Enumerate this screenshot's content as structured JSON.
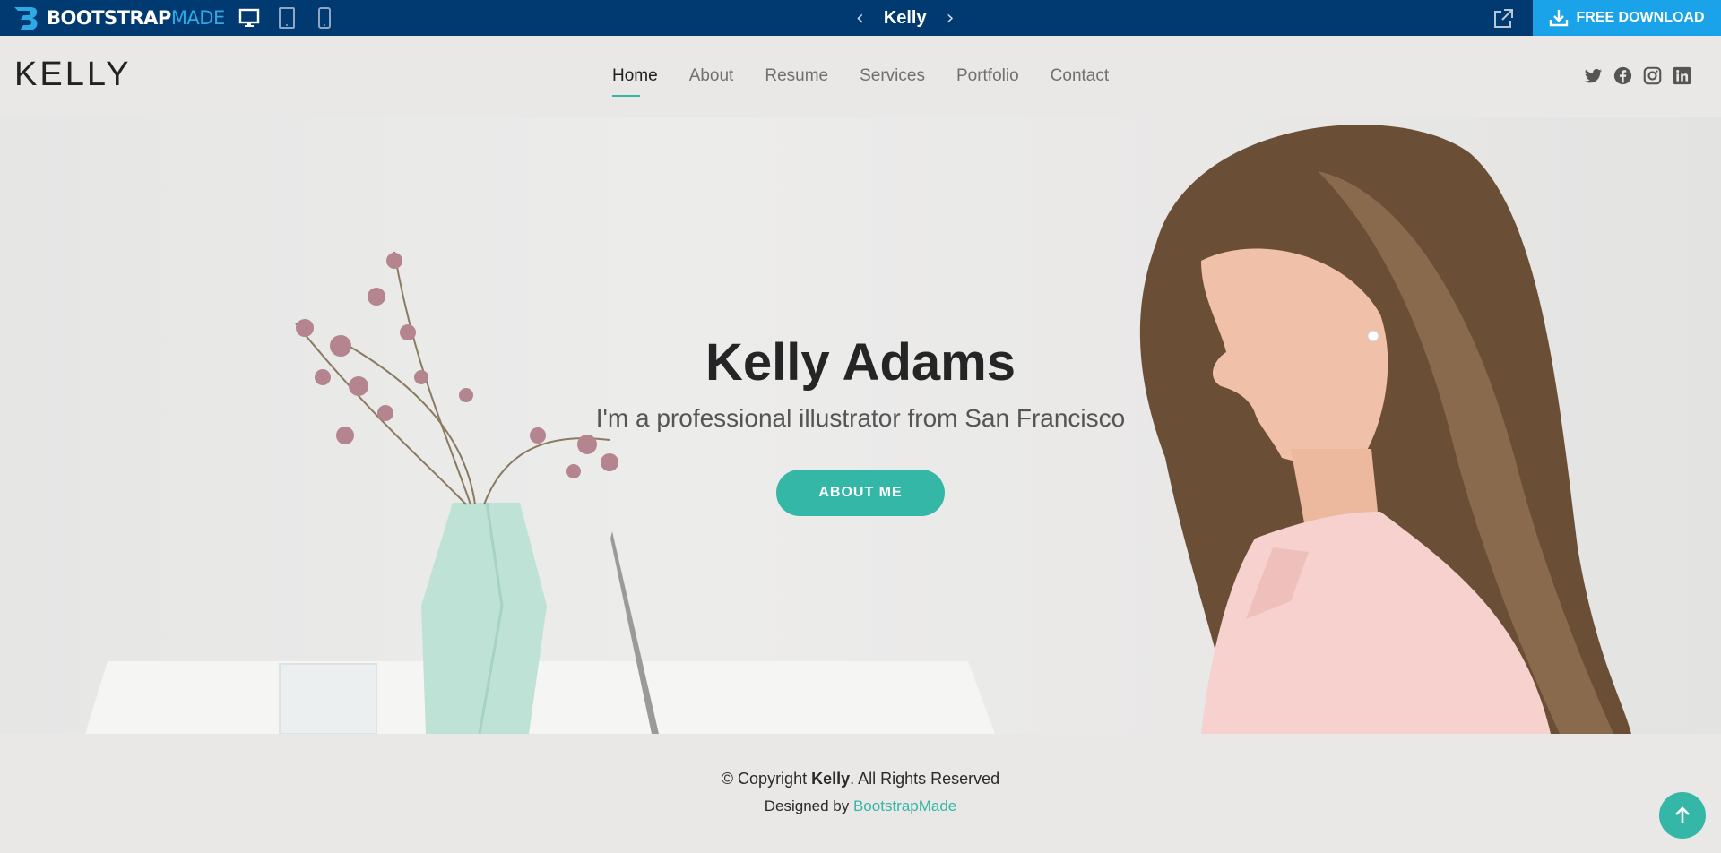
{
  "preview_bar": {
    "brand_part1": "BOOTSTRAP",
    "brand_part2": "MADE",
    "title": "Kelly",
    "prev_arrow": "‹",
    "next_arrow": "›",
    "download_label": "FREE DOWNLOAD",
    "devices": [
      "desktop-icon",
      "tablet-icon",
      "mobile-icon"
    ]
  },
  "header": {
    "logo": "KELLY",
    "nav": [
      "Home",
      "About",
      "Resume",
      "Services",
      "Portfolio",
      "Contact"
    ],
    "active_nav": "Home",
    "social": [
      "twitter-icon",
      "facebook-icon",
      "instagram-icon",
      "linkedin-icon"
    ]
  },
  "hero": {
    "title": "Kelly Adams",
    "subtitle": "I'm a professional illustrator from San Francisco",
    "button": "ABOUT ME"
  },
  "footer": {
    "copy_prefix": "© Copyright ",
    "copy_name": "Kelly",
    "copy_suffix": ". All Rights Reserved",
    "designed_prefix": "Designed by ",
    "designed_link": "BootstrapMade"
  },
  "colors": {
    "topbar": "#003a70",
    "download": "#1aa3e8",
    "accent": "#34b7a7"
  }
}
